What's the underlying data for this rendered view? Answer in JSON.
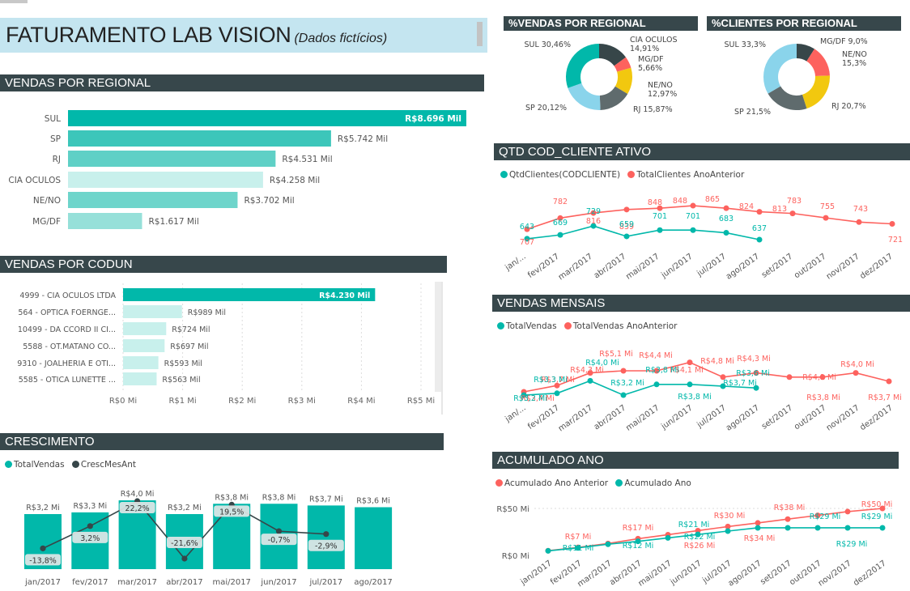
{
  "title": {
    "main": "FATURAMENTO LAB VISION",
    "sub": "(Dados fictícios)"
  },
  "colors": {
    "teal": "#01b8aa",
    "red": "#fd625e",
    "dark": "#374649",
    "yellow": "#f2c80f",
    "grey": "#5f6b6d",
    "blue": "#8ad4eb",
    "header": "#37474b"
  },
  "vendas_regional": {
    "header": "VENDAS POR REGIONAL",
    "chart_data": {
      "type": "bar",
      "categories": [
        "SUL",
        "SP",
        "RJ",
        "CIA OCULOS",
        "NE/NO",
        "MG/DF"
      ],
      "values": [
        8696,
        5742,
        4531,
        4258,
        3702,
        1617
      ],
      "labels": [
        "R$8.696 Mil",
        "R$5.742 Mil",
        "R$4.531 Mil",
        "R$4.258 Mil",
        "R$3.702 Mil",
        "R$1.617 Mil"
      ],
      "colors": [
        "#01b8aa",
        "#3cc6ba",
        "#5fd0c6",
        "#c8f0ec",
        "#6ed5cb",
        "#96e0d9"
      ]
    }
  },
  "vendas_codun": {
    "header": "VENDAS POR CODUN",
    "chart_data": {
      "type": "bar",
      "categories": [
        "4999 - CIA OCULOS LTDA",
        "564 - OPTICA FOERNGE...",
        "10499 - DA CCORD II CI...",
        "5588 - OT.MATANO CO...",
        "9310 - JOALHERIA E OTI...",
        "5585 - OTICA LUNETTE ..."
      ],
      "values": [
        4.23,
        0.989,
        0.724,
        0.697,
        0.593,
        0.563
      ],
      "labels": [
        "R$4.230 Mil",
        "R$989 Mil",
        "R$724 Mil",
        "R$697 Mil",
        "R$593 Mil",
        "R$563 Mil"
      ],
      "xticks": [
        "R$0 Mi",
        "R$1 Mi",
        "R$2 Mi",
        "R$3 Mi",
        "R$4 Mi",
        "R$5 Mi"
      ],
      "xlim": [
        0,
        5
      ]
    }
  },
  "crescimento": {
    "header": "CRESCIMENTO",
    "legend": [
      "TotalVendas",
      "CrescMesAnt"
    ],
    "chart_data": {
      "type": "bar",
      "categories": [
        "jan/2017",
        "fev/2017",
        "mar/2017",
        "abr/2017",
        "mai/2017",
        "jun/2017",
        "jul/2017",
        "ago/2017"
      ],
      "bar_values": [
        3.2,
        3.3,
        4.0,
        3.2,
        3.8,
        3.8,
        3.7,
        3.6
      ],
      "bar_labels": [
        "R$3,2 Mi",
        "R$3,3 Mi",
        "R$4,0 Mi",
        "R$3,2 Mi",
        "R$3,8 Mi",
        "R$3,8 Mi",
        "R$3,7 Mi",
        "R$3,6 Mi"
      ],
      "line_values": [
        -13.8,
        3.2,
        22.2,
        -21.6,
        19.5,
        -0.7,
        -2.9,
        null
      ],
      "line_labels": [
        "-13,8%",
        "3,2%",
        "22,2%",
        "-21,6%",
        "19,5%",
        "-0,7%",
        "-2,9%",
        ""
      ]
    }
  },
  "pct_vendas": {
    "header": "%VENDAS POR REGIONAL",
    "chart_data": {
      "type": "pie",
      "slices": [
        {
          "name": "CIA OCULOS",
          "value": 14.91,
          "label": "14,91%",
          "color": "#374649"
        },
        {
          "name": "MG/DF",
          "value": 5.66,
          "label": "5,66%",
          "color": "#fd625e"
        },
        {
          "name": "NE/NO",
          "value": 12.97,
          "label": "12,97%",
          "color": "#f2c80f"
        },
        {
          "name": "RJ",
          "value": 15.87,
          "label": "15,87%",
          "color": "#5f6b6d"
        },
        {
          "name": "SP",
          "value": 20.12,
          "label": "20,12%",
          "color": "#8ad4eb"
        },
        {
          "name": "SUL",
          "value": 30.46,
          "label": "30,46%",
          "color": "#01b8aa"
        }
      ]
    }
  },
  "pct_clientes": {
    "header": "%CLIENTES POR REGIONAL",
    "chart_data": {
      "type": "pie",
      "slices": [
        {
          "name": "MG/DF",
          "value": 9.0,
          "label": "9,0%",
          "color": "#374649"
        },
        {
          "name": "NE/NO",
          "value": 15.3,
          "label": "15,3%",
          "color": "#fd625e"
        },
        {
          "name": "RJ",
          "value": 20.7,
          "label": "20,7%",
          "color": "#f2c80f"
        },
        {
          "name": "SP",
          "value": 21.5,
          "label": "21,5%",
          "color": "#5f6b6d"
        },
        {
          "name": "SUL",
          "value": 33.3,
          "label": "33,3%",
          "color": "#8ad4eb"
        }
      ]
    }
  },
  "months": [
    "jan/...",
    "fev/2017",
    "mar/2017",
    "abr/2017",
    "mai/2017",
    "jun/2017",
    "jul/2017",
    "ago/2017",
    "set/2017",
    "out/2017",
    "nov/2017",
    "dez/2017"
  ],
  "qtd_cliente": {
    "header": "QTD COD_CLIENTE ATIVO",
    "legend": [
      "QtdClientes(CODCLIENTE)",
      "TotalClientes AnoAnterior"
    ],
    "chart_data": {
      "type": "line",
      "series": [
        {
          "name": "QtdClientes(CODCLIENTE)",
          "values": [
            643,
            669,
            729,
            659,
            701,
            701,
            683,
            637,
            null,
            null,
            null,
            null
          ],
          "labels": [
            "643",
            "669",
            "729",
            "659",
            "701",
            "701",
            "683",
            "637",
            "",
            "",
            "",
            ""
          ]
        },
        {
          "name": "TotalClientes AnoAnterior",
          "values": [
            707,
            782,
            816,
            839,
            848,
            865,
            848,
            824,
            813,
            783,
            755,
            743,
            721
          ],
          "labels": [
            "707",
            "782",
            "816",
            "839",
            "848",
            "865",
            "",
            "824",
            "813",
            "783",
            "755",
            "743",
            "721"
          ]
        }
      ]
    }
  },
  "vendas_mensais": {
    "header": "VENDAS MENSAIS",
    "legend": [
      "TotalVendas",
      "TotalVendas AnoAnterior"
    ],
    "chart_data": {
      "type": "line",
      "series": [
        {
          "name": "TotalVendas",
          "values": [
            3.2,
            3.3,
            4.0,
            3.2,
            3.8,
            3.8,
            3.7,
            3.6,
            null,
            null,
            null,
            null
          ],
          "labels": [
            "R$3,2 Mi",
            "R$3,3 Mi",
            "R$4,0 Mi",
            "R$3,2 Mi",
            "R$3,8 Mi",
            "R$3,8 Mi",
            "R$3,7 Mi",
            "R$3,6 Mi",
            "",
            "",
            "",
            ""
          ]
        },
        {
          "name": "TotalVendas AnoAnterior",
          "values": [
            3.4,
            3.7,
            4.3,
            5.1,
            4.4,
            4.1,
            4.8,
            4.1,
            4.3,
            4.1,
            3.8,
            4.0,
            3.7
          ],
          "labels": [
            "R$3,4 Mi",
            "R$3,7 Mi",
            "R$4,3 Mi",
            "R$5,1 Mi",
            "R$4,4 Mi",
            "R$4,1 Mi",
            "R$4,8 Mi",
            "R$4,1 Mi",
            "R$4,3 Mi",
            "R$4,1 Mi",
            "R$3,8 Mi",
            "R$4,0 Mi",
            "R$3,7 Mi"
          ]
        }
      ]
    }
  },
  "acumulado": {
    "header": "ACUMULADO ANO",
    "legend": [
      "Acumulado Ano Anterior",
      "Acumulado Ano"
    ],
    "yticks": [
      "R$50 Mi",
      "R$0 Mi"
    ],
    "chart_data": {
      "type": "line",
      "series": [
        {
          "name": "Acumulado Ano Anterior",
          "values": [
            3.4,
            7.0,
            11.3,
            16.6,
            21.0,
            25.5,
            30.0,
            34.0,
            38.2,
            42.3,
            46.5,
            50.0
          ],
          "labels": [
            "",
            "R$7 Mi",
            "",
            "R$17 Mi",
            "",
            "R$26 Mi",
            "R$30 Mi",
            "R$34 Mi",
            "R$38 Mi",
            "",
            "",
            "R$50 Mi"
          ]
        },
        {
          "name": "Acumulado Ano",
          "values": [
            3.2,
            6.5,
            10.5,
            13.7,
            17.5,
            21.3,
            25.0,
            28.6,
            28.6,
            28.6,
            28.6,
            28.6
          ],
          "labels": [
            "",
            "R$11 Mi",
            "",
            "R$12 Mi",
            "",
            "R$21 Mi",
            "R$22 Mi",
            "",
            "",
            "R$29 Mi",
            "R$29 Mi",
            "R$29 Mi"
          ]
        }
      ],
      "ylim": [
        0,
        50
      ]
    }
  }
}
